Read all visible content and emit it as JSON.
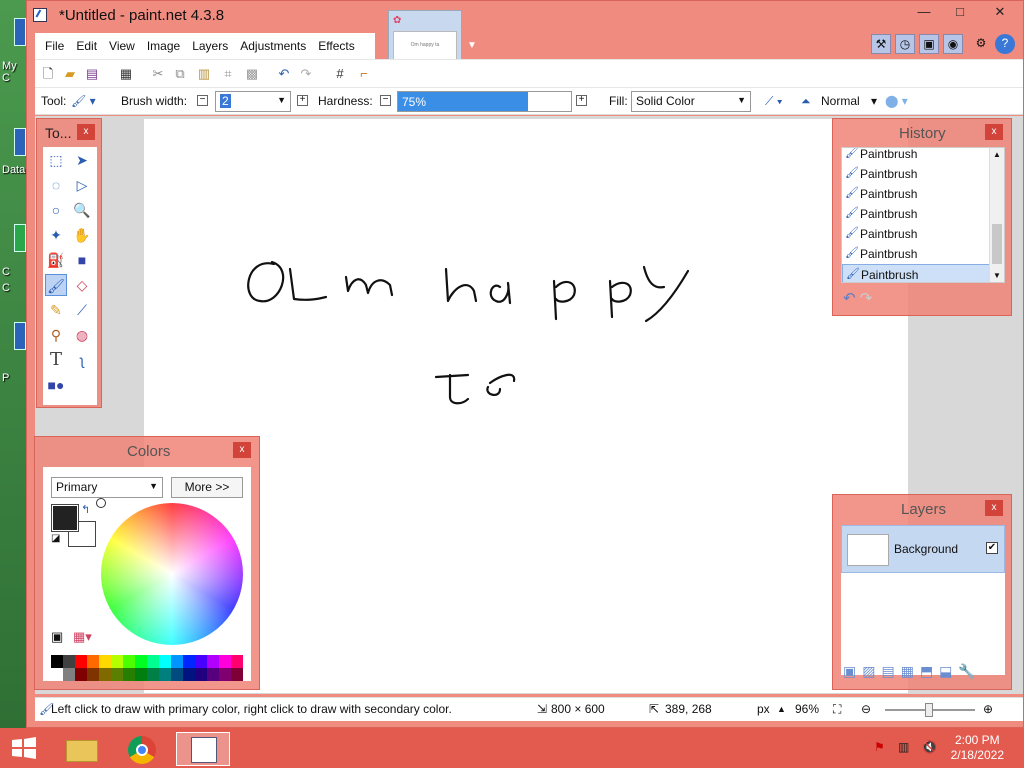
{
  "desktop": {
    "labels": [
      "My C",
      "Data",
      "C",
      "C",
      "P"
    ]
  },
  "window": {
    "title": "*Untitled - paint.net 4.3.8",
    "controls": {
      "minimize": "—",
      "maximize": "□",
      "close": "✕"
    }
  },
  "thumbnail": {
    "text": "Om happy ta"
  },
  "menu": [
    "File",
    "Edit",
    "View",
    "Image",
    "Layers",
    "Adjustments",
    "Effects"
  ],
  "toolbar": {
    "tool_label": "Tool:",
    "brush_width_label": "Brush width:",
    "brush_width_value": "2",
    "hardness_label": "Hardness:",
    "hardness_value": "75%",
    "hardness_fraction": 0.75,
    "fill_label": "Fill:",
    "fill_value": "Solid Color",
    "blend_mode": "Normal"
  },
  "tools_panel": {
    "title": "To...",
    "close": "x"
  },
  "history": {
    "title": "History",
    "close": "x",
    "items": [
      "Paintbrush",
      "Paintbrush",
      "Paintbrush",
      "Paintbrush",
      "Paintbrush",
      "Paintbrush",
      "Paintbrush"
    ]
  },
  "colors": {
    "title": "Colors",
    "close": "x",
    "mode": "Primary",
    "more_label": "More >>",
    "primary": "#222222",
    "secondary": "#ffffff",
    "palette": [
      "#000000",
      "#404040",
      "#ff0000",
      "#ff6a00",
      "#ffd800",
      "#b6ff00",
      "#4cff00",
      "#00ff21",
      "#00ff90",
      "#00ffff",
      "#0094ff",
      "#0026ff",
      "#4800ff",
      "#b200ff",
      "#ff00dc",
      "#ff006e",
      "#ffffff",
      "#808080",
      "#7f0000",
      "#7f3300",
      "#7f6a00",
      "#5b7f00",
      "#267f00",
      "#007f0e",
      "#007f46",
      "#007f7f",
      "#004a7f",
      "#00137f",
      "#21007f",
      "#57007f",
      "#7f006e",
      "#7f0037"
    ]
  },
  "layers": {
    "title": "Layers",
    "close": "x",
    "layer_name": "Background"
  },
  "status": {
    "hint": "Left click to draw with primary color, right click to draw with secondary color.",
    "image_size": "800 × 600",
    "cursor_pos": "389, 268",
    "unit": "px",
    "zoom": "96%"
  },
  "taskbar": {
    "time": "2:00 PM",
    "date": "2/18/2022"
  }
}
